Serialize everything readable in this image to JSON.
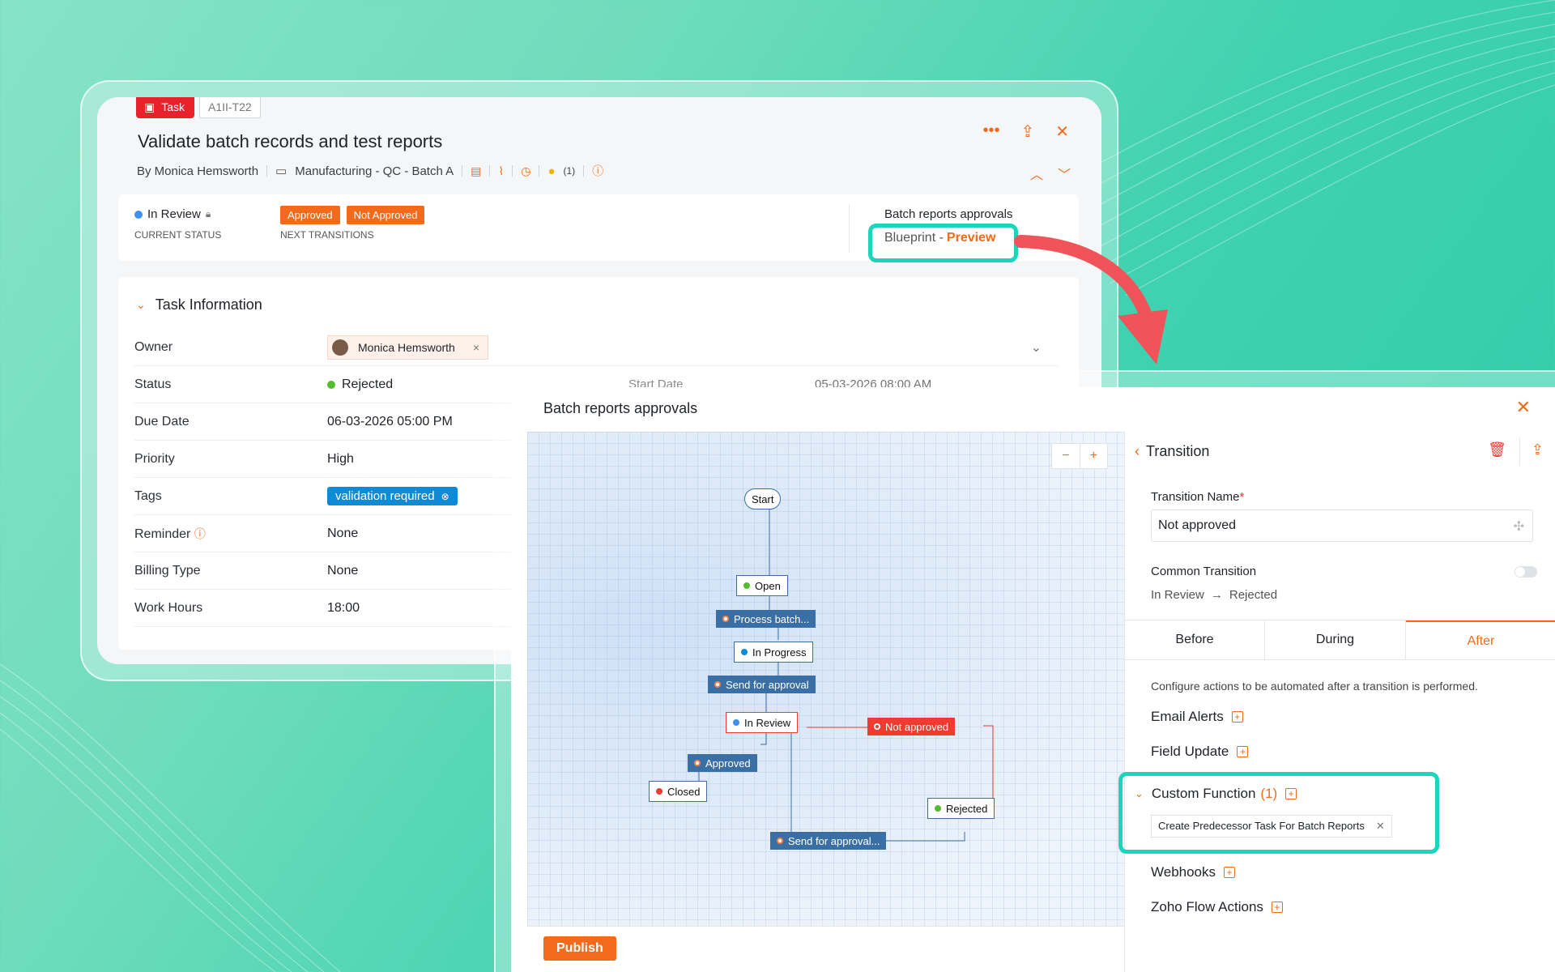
{
  "task": {
    "type_label": "Task",
    "id": "A1II-T22",
    "title": "Validate batch records and test reports",
    "author": "By Monica Hemsworth",
    "project": "Manufacturing - QC - Batch A",
    "count": "(1)",
    "current_status": "In Review",
    "current_status_label": "CURRENT STATUS",
    "next_transitions": [
      "Approved",
      "Not Approved"
    ],
    "next_transitions_label": "NEXT TRANSITIONS",
    "blueprint_name": "Batch reports approvals",
    "blueprint_prefix": "Blueprint -",
    "blueprint_action": "Preview",
    "section_title": "Task Information",
    "fields": [
      {
        "key": "Owner",
        "value": "Monica Hemsworth"
      },
      {
        "key": "Status",
        "value": "Rejected"
      },
      {
        "key": "Due Date",
        "value": "06-03-2026 05:00 PM"
      },
      {
        "key": "Priority",
        "value": "High"
      },
      {
        "key": "Tags",
        "value": "validation required"
      },
      {
        "key": "Reminder",
        "value": "None"
      },
      {
        "key": "Billing Type",
        "value": "None"
      },
      {
        "key": "Work Hours",
        "value": "18:00"
      }
    ],
    "start_date_label": "Start Date",
    "start_date_value": "05-03-2026 08:00 AM"
  },
  "blueprint": {
    "title": "Batch reports approvals",
    "zoom_out": "−",
    "zoom_in": "+",
    "nodes": {
      "start": "Start",
      "open": "Open",
      "in_progress": "In Progress",
      "in_review": "In Review",
      "closed": "Closed",
      "rejected": "Rejected"
    },
    "transitions": {
      "process": "Process batch...",
      "send": "Send for approval",
      "not_approved": "Not approved",
      "approved": "Approved",
      "send_again": "Send for approval..."
    },
    "publish": "Publish"
  },
  "transition_panel": {
    "header": "Transition",
    "name_label": "Transition Name",
    "name_value": "Not approved",
    "common_label": "Common Transition",
    "from": "In Review",
    "arrow": "→",
    "to": "Rejected",
    "tabs": [
      "Before",
      "During",
      "After"
    ],
    "active_tab": "After",
    "description": "Configure actions to be automated after a transition is performed.",
    "email_alerts": "Email Alerts",
    "field_update": "Field Update",
    "custom_function": "Custom Function",
    "custom_function_count": "(1)",
    "custom_function_item": "Create Predecessor Task For Batch Reports",
    "webhooks": "Webhooks",
    "zoho_flow": "Zoho Flow Actions"
  },
  "colors": {
    "accent": "#f26a1b",
    "highlight": "#1cd6bb",
    "task_red": "#e8212b",
    "node_blue": "#3a6fa6",
    "reject_red": "#ef3b30"
  }
}
